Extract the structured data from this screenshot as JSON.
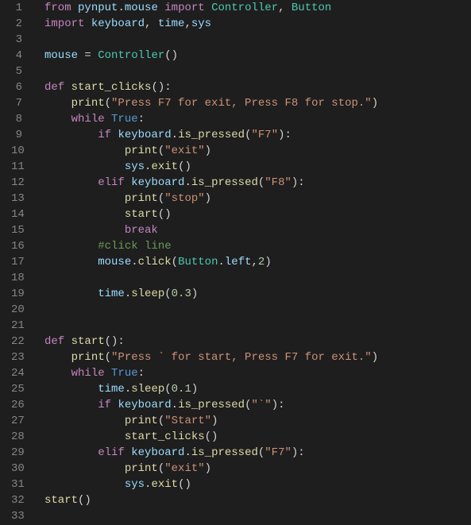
{
  "lineCount": 33,
  "tokens": {
    "l1": [
      {
        "t": "from ",
        "c": "kw"
      },
      {
        "t": "pynput",
        "c": "var"
      },
      {
        "t": ".",
        "c": "op"
      },
      {
        "t": "mouse",
        "c": "var"
      },
      {
        "t": " ",
        "c": "op"
      },
      {
        "t": "import ",
        "c": "kw"
      },
      {
        "t": "Controller",
        "c": "cls"
      },
      {
        "t": ", ",
        "c": "op"
      },
      {
        "t": "Button",
        "c": "cls"
      }
    ],
    "l2": [
      {
        "t": "import ",
        "c": "kw"
      },
      {
        "t": "keyboard",
        "c": "var"
      },
      {
        "t": ", ",
        "c": "op"
      },
      {
        "t": "time",
        "c": "var"
      },
      {
        "t": ",",
        "c": "op"
      },
      {
        "t": "sys",
        "c": "var"
      }
    ],
    "l3": [],
    "l4": [
      {
        "t": "mouse",
        "c": "var"
      },
      {
        "t": " = ",
        "c": "op"
      },
      {
        "t": "Controller",
        "c": "cls"
      },
      {
        "t": "()",
        "c": "op"
      }
    ],
    "l5": [],
    "l6": [
      {
        "t": "def ",
        "c": "kw"
      },
      {
        "t": "start_clicks",
        "c": "fn"
      },
      {
        "t": "():",
        "c": "op"
      }
    ],
    "l7": [
      {
        "t": "    ",
        "c": "op"
      },
      {
        "t": "print",
        "c": "fn"
      },
      {
        "t": "(",
        "c": "op"
      },
      {
        "t": "\"Press F7 for exit, Press F8 for stop.\"",
        "c": "str"
      },
      {
        "t": ")",
        "c": "op"
      }
    ],
    "l8": [
      {
        "t": "    ",
        "c": "op"
      },
      {
        "t": "while ",
        "c": "kw"
      },
      {
        "t": "True",
        "c": "bool"
      },
      {
        "t": ":",
        "c": "op"
      }
    ],
    "l9": [
      {
        "t": "        ",
        "c": "op"
      },
      {
        "t": "if ",
        "c": "kw"
      },
      {
        "t": "keyboard",
        "c": "var"
      },
      {
        "t": ".",
        "c": "op"
      },
      {
        "t": "is_pressed",
        "c": "fn"
      },
      {
        "t": "(",
        "c": "op"
      },
      {
        "t": "\"F7\"",
        "c": "str"
      },
      {
        "t": "):",
        "c": "op"
      }
    ],
    "l10": [
      {
        "t": "            ",
        "c": "op"
      },
      {
        "t": "print",
        "c": "fn"
      },
      {
        "t": "(",
        "c": "op"
      },
      {
        "t": "\"exit\"",
        "c": "str"
      },
      {
        "t": ")",
        "c": "op"
      }
    ],
    "l11": [
      {
        "t": "            ",
        "c": "op"
      },
      {
        "t": "sys",
        "c": "var"
      },
      {
        "t": ".",
        "c": "op"
      },
      {
        "t": "exit",
        "c": "fn"
      },
      {
        "t": "()",
        "c": "op"
      }
    ],
    "l12": [
      {
        "t": "        ",
        "c": "op"
      },
      {
        "t": "elif ",
        "c": "kw"
      },
      {
        "t": "keyboard",
        "c": "var"
      },
      {
        "t": ".",
        "c": "op"
      },
      {
        "t": "is_pressed",
        "c": "fn"
      },
      {
        "t": "(",
        "c": "op"
      },
      {
        "t": "\"F8\"",
        "c": "str"
      },
      {
        "t": "):",
        "c": "op"
      }
    ],
    "l13": [
      {
        "t": "            ",
        "c": "op"
      },
      {
        "t": "print",
        "c": "fn"
      },
      {
        "t": "(",
        "c": "op"
      },
      {
        "t": "\"stop\"",
        "c": "str"
      },
      {
        "t": ")",
        "c": "op"
      }
    ],
    "l14": [
      {
        "t": "            ",
        "c": "op"
      },
      {
        "t": "start",
        "c": "fn"
      },
      {
        "t": "()",
        "c": "op"
      }
    ],
    "l15": [
      {
        "t": "            ",
        "c": "op"
      },
      {
        "t": "break",
        "c": "kw"
      }
    ],
    "l16": [
      {
        "t": "        ",
        "c": "op"
      },
      {
        "t": "#click line",
        "c": "cmt"
      }
    ],
    "l17": [
      {
        "t": "        ",
        "c": "op"
      },
      {
        "t": "mouse",
        "c": "var"
      },
      {
        "t": ".",
        "c": "op"
      },
      {
        "t": "click",
        "c": "fn"
      },
      {
        "t": "(",
        "c": "op"
      },
      {
        "t": "Button",
        "c": "cls"
      },
      {
        "t": ".",
        "c": "op"
      },
      {
        "t": "left",
        "c": "var"
      },
      {
        "t": ",",
        "c": "op"
      },
      {
        "t": "2",
        "c": "num"
      },
      {
        "t": ")",
        "c": "op"
      }
    ],
    "l18": [],
    "l19": [
      {
        "t": "        ",
        "c": "op"
      },
      {
        "t": "time",
        "c": "var"
      },
      {
        "t": ".",
        "c": "op"
      },
      {
        "t": "sleep",
        "c": "fn"
      },
      {
        "t": "(",
        "c": "op"
      },
      {
        "t": "0.3",
        "c": "num"
      },
      {
        "t": ")",
        "c": "op"
      }
    ],
    "l20": [],
    "l21": [],
    "l22": [
      {
        "t": "def ",
        "c": "kw"
      },
      {
        "t": "start",
        "c": "fn"
      },
      {
        "t": "():",
        "c": "op"
      }
    ],
    "l23": [
      {
        "t": "    ",
        "c": "op"
      },
      {
        "t": "print",
        "c": "fn"
      },
      {
        "t": "(",
        "c": "op"
      },
      {
        "t": "\"Press ` for start, Press F7 for exit.\"",
        "c": "str"
      },
      {
        "t": ")",
        "c": "op"
      }
    ],
    "l24": [
      {
        "t": "    ",
        "c": "op"
      },
      {
        "t": "while ",
        "c": "kw"
      },
      {
        "t": "True",
        "c": "bool"
      },
      {
        "t": ":",
        "c": "op"
      }
    ],
    "l25": [
      {
        "t": "        ",
        "c": "op"
      },
      {
        "t": "time",
        "c": "var"
      },
      {
        "t": ".",
        "c": "op"
      },
      {
        "t": "sleep",
        "c": "fn"
      },
      {
        "t": "(",
        "c": "op"
      },
      {
        "t": "0.1",
        "c": "num"
      },
      {
        "t": ")",
        "c": "op"
      }
    ],
    "l26": [
      {
        "t": "        ",
        "c": "op"
      },
      {
        "t": "if ",
        "c": "kw"
      },
      {
        "t": "keyboard",
        "c": "var"
      },
      {
        "t": ".",
        "c": "op"
      },
      {
        "t": "is_pressed",
        "c": "fn"
      },
      {
        "t": "(",
        "c": "op"
      },
      {
        "t": "\"`\"",
        "c": "str"
      },
      {
        "t": "):",
        "c": "op"
      }
    ],
    "l27": [
      {
        "t": "            ",
        "c": "op"
      },
      {
        "t": "print",
        "c": "fn"
      },
      {
        "t": "(",
        "c": "op"
      },
      {
        "t": "\"Start\"",
        "c": "str"
      },
      {
        "t": ")",
        "c": "op"
      }
    ],
    "l28": [
      {
        "t": "            ",
        "c": "op"
      },
      {
        "t": "start_clicks",
        "c": "fn"
      },
      {
        "t": "()",
        "c": "op"
      }
    ],
    "l29": [
      {
        "t": "        ",
        "c": "op"
      },
      {
        "t": "elif ",
        "c": "kw"
      },
      {
        "t": "keyboard",
        "c": "var"
      },
      {
        "t": ".",
        "c": "op"
      },
      {
        "t": "is_pressed",
        "c": "fn"
      },
      {
        "t": "(",
        "c": "op"
      },
      {
        "t": "\"F7\"",
        "c": "str"
      },
      {
        "t": "):",
        "c": "op"
      }
    ],
    "l30": [
      {
        "t": "            ",
        "c": "op"
      },
      {
        "t": "print",
        "c": "fn"
      },
      {
        "t": "(",
        "c": "op"
      },
      {
        "t": "\"exit\"",
        "c": "str"
      },
      {
        "t": ")",
        "c": "op"
      }
    ],
    "l31": [
      {
        "t": "            ",
        "c": "op"
      },
      {
        "t": "sys",
        "c": "var"
      },
      {
        "t": ".",
        "c": "op"
      },
      {
        "t": "exit",
        "c": "fn"
      },
      {
        "t": "()",
        "c": "op"
      }
    ],
    "l32": [
      {
        "t": "start",
        "c": "fn"
      },
      {
        "t": "()",
        "c": "op"
      }
    ],
    "l33": []
  }
}
